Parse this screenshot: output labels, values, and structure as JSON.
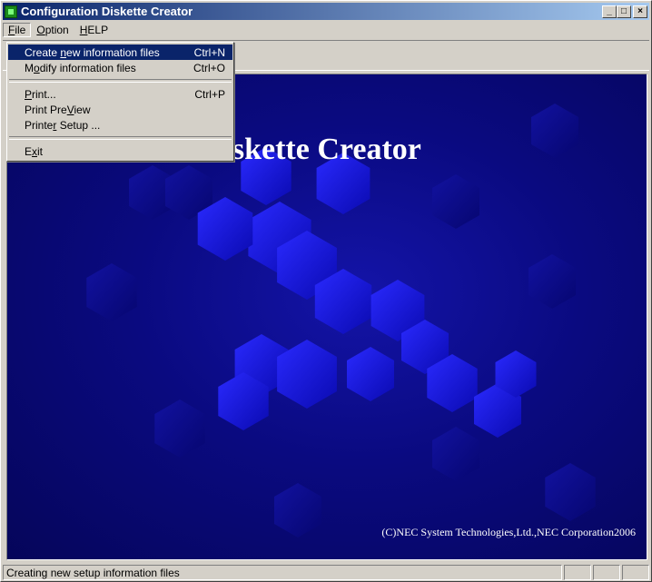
{
  "window": {
    "title": "Configuration Diskette Creator",
    "buttons": {
      "minimize": "_",
      "maximize": "□",
      "close": "×"
    }
  },
  "menubar": {
    "items": [
      {
        "label": "File",
        "accel_pre": "",
        "accel": "F",
        "accel_post": "ile"
      },
      {
        "label": "Option",
        "accel_pre": "",
        "accel": "O",
        "accel_post": "ption"
      },
      {
        "label": "HELP",
        "accel_pre": "",
        "accel": "H",
        "accel_post": "ELP"
      }
    ]
  },
  "file_menu": {
    "groups": [
      [
        {
          "pre": "Create ",
          "accel": "n",
          "post": "ew information files",
          "shortcut": "Ctrl+N",
          "highlighted": true
        },
        {
          "pre": "M",
          "accel": "o",
          "post": "dify information files",
          "shortcut": "Ctrl+O",
          "highlighted": false
        }
      ],
      [
        {
          "pre": "",
          "accel": "P",
          "post": "rint...",
          "shortcut": "Ctrl+P",
          "highlighted": false
        },
        {
          "pre": "Print Pre",
          "accel": "V",
          "post": "iew",
          "shortcut": "",
          "highlighted": false
        },
        {
          "pre": "Printe",
          "accel": "r",
          "post": " Setup ...",
          "shortcut": "",
          "highlighted": false
        }
      ],
      [
        {
          "pre": "E",
          "accel": "x",
          "post": "it",
          "shortcut": "",
          "highlighted": false
        }
      ]
    ]
  },
  "splash": {
    "title_visible": "ion Diskette Creator",
    "copyright": "(C)NEC System Technologies,Ltd.,NEC Corporation2006"
  },
  "statusbar": {
    "text": "Creating new setup information files"
  },
  "colors": {
    "accent": "#0a246a",
    "splash_bg": "#05055a",
    "hex_bright": "#1a1aff"
  }
}
